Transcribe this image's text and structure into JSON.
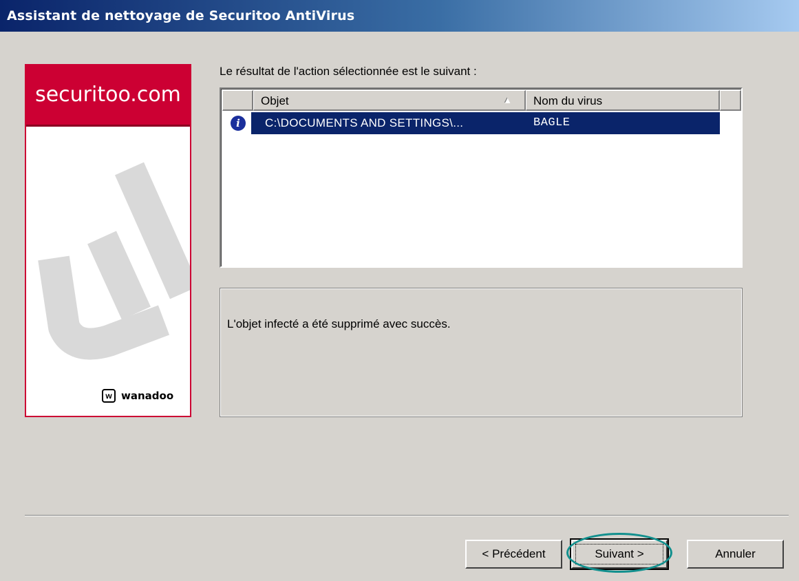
{
  "window": {
    "title": "Assistant de nettoyage de Securitoo AntiVirus"
  },
  "brand": {
    "site": "securitoo.com",
    "partner": "wanadoo",
    "partner_mark": "w"
  },
  "result": {
    "label": "Le résultat de l'action sélectionnée est le suivant :",
    "columns": [
      "Objet",
      "Nom du virus"
    ],
    "rows": [
      {
        "icon": "info-icon",
        "object": "C:\\DOCUMENTS AND SETTINGS\\...",
        "virus": "BAGLE",
        "selected": true
      }
    ]
  },
  "message": "L'objet infecté a été supprimé avec succès.",
  "buttons": {
    "back": "< Précédent",
    "next": "Suivant >",
    "cancel": "Annuler"
  },
  "colors": {
    "brand_red": "#cc0033",
    "selection": "#0a246a",
    "highlight_ring": "#12908e"
  }
}
